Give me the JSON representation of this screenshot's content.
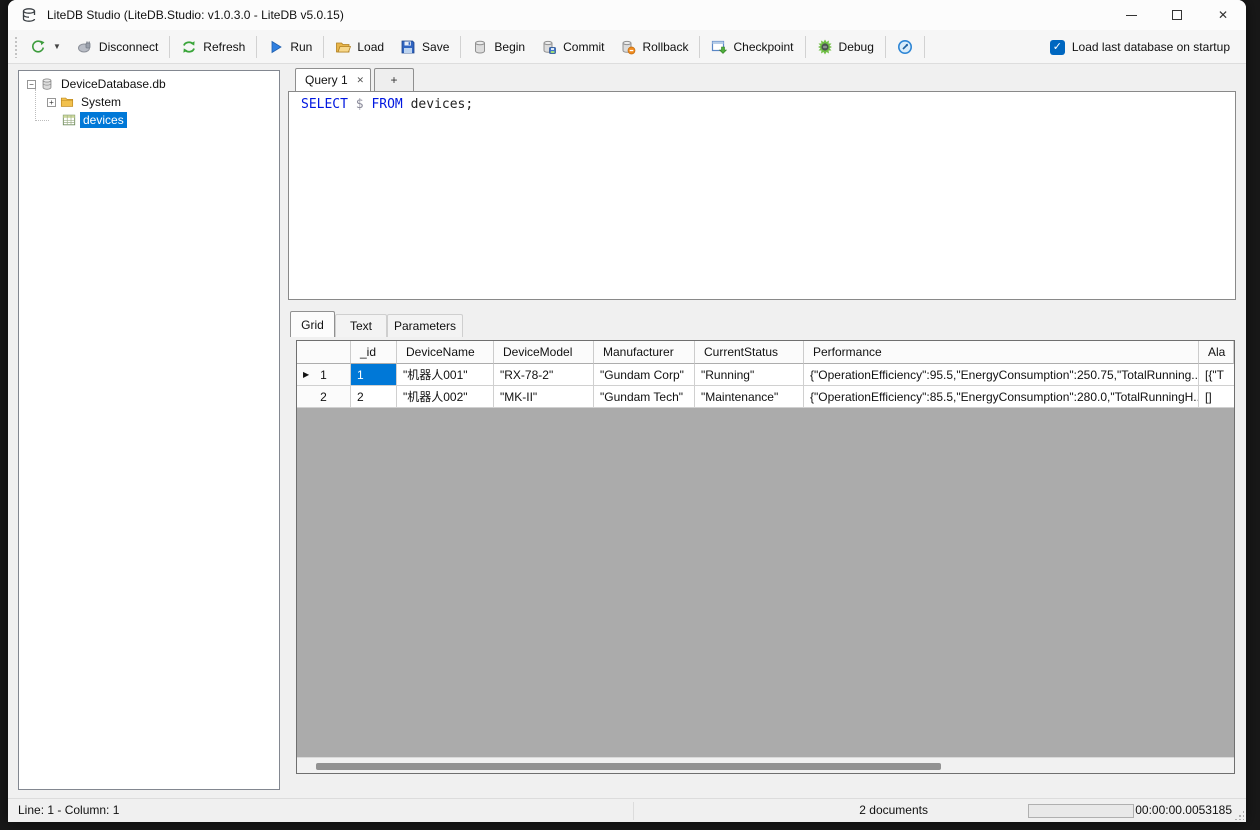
{
  "window": {
    "title": "LiteDB Studio (LiteDB.Studio: v1.0.3.0 - LiteDB v5.0.15)",
    "close_glyph": "✕"
  },
  "toolbar": {
    "buttons": [
      {
        "icon": "connect-icon",
        "label": ""
      },
      {
        "icon": "disconnect-icon",
        "label": "Disconnect"
      },
      {
        "icon": "refresh-icon",
        "label": "Refresh"
      },
      {
        "icon": "run-icon",
        "label": "Run"
      },
      {
        "icon": "open-folder-icon",
        "label": "Load"
      },
      {
        "icon": "save-icon",
        "label": "Save"
      },
      {
        "icon": "database-icon",
        "label": "Begin"
      },
      {
        "icon": "database-commit-icon",
        "label": "Commit"
      },
      {
        "icon": "database-rollback-icon",
        "label": "Rollback"
      },
      {
        "icon": "checkpoint-icon",
        "label": "Checkpoint"
      },
      {
        "icon": "debug-icon",
        "label": "Debug"
      },
      {
        "icon": "shell-icon",
        "label": ""
      }
    ],
    "startup_checkbox": {
      "label": "Load last database on startup",
      "checked": true,
      "check_glyph": "✓"
    }
  },
  "tree": {
    "root_label": "DeviceDatabase.db",
    "root_expander": "−",
    "items": [
      {
        "label": "System",
        "icon": "folder-icon",
        "expander": "+",
        "selected": false
      },
      {
        "label": "devices",
        "icon": "table-icon",
        "expander": "",
        "selected": true
      }
    ]
  },
  "query_tabs": {
    "active_label": "Query 1",
    "close_glyph": "✕",
    "new_tab_label": "+"
  },
  "editor": {
    "tokens": [
      {
        "text": "SELECT ",
        "type": "keyword"
      },
      {
        "text": "$ ",
        "type": "param"
      },
      {
        "text": "FROM ",
        "type": "keyword"
      },
      {
        "text": "devices;",
        "type": "plain"
      }
    ]
  },
  "result_tabs": {
    "grid": "Grid",
    "text": "Text",
    "parameters": "Parameters"
  },
  "grid": {
    "current_row_marker": "▶",
    "columns": [
      "_id",
      "DeviceName",
      "DeviceModel",
      "Manufacturer",
      "CurrentStatus",
      "Performance",
      "Ala"
    ],
    "rows": [
      {
        "header": "1",
        "current": true,
        "selected_cell": 0,
        "cells": [
          "1",
          "\"机器人001\"",
          "\"RX-78-2\"",
          "\"Gundam Corp\"",
          "\"Running\"",
          "{\"OperationEfficiency\":95.5,\"EnergyConsumption\":250.75,\"TotalRunning...",
          "[{\"T"
        ]
      },
      {
        "header": "2",
        "current": false,
        "selected_cell": -1,
        "cells": [
          "2",
          "\"机器人002\"",
          "\"MK-II\"",
          "\"Gundam Tech\"",
          "\"Maintenance\"",
          "{\"OperationEfficiency\":85.5,\"EnergyConsumption\":280.0,\"TotalRunningH...",
          "[]"
        ]
      }
    ]
  },
  "statusbar": {
    "caret": "Line: 1 - Column: 1",
    "documents": "2 documents",
    "elapsed": "00:00:00.0053185"
  }
}
